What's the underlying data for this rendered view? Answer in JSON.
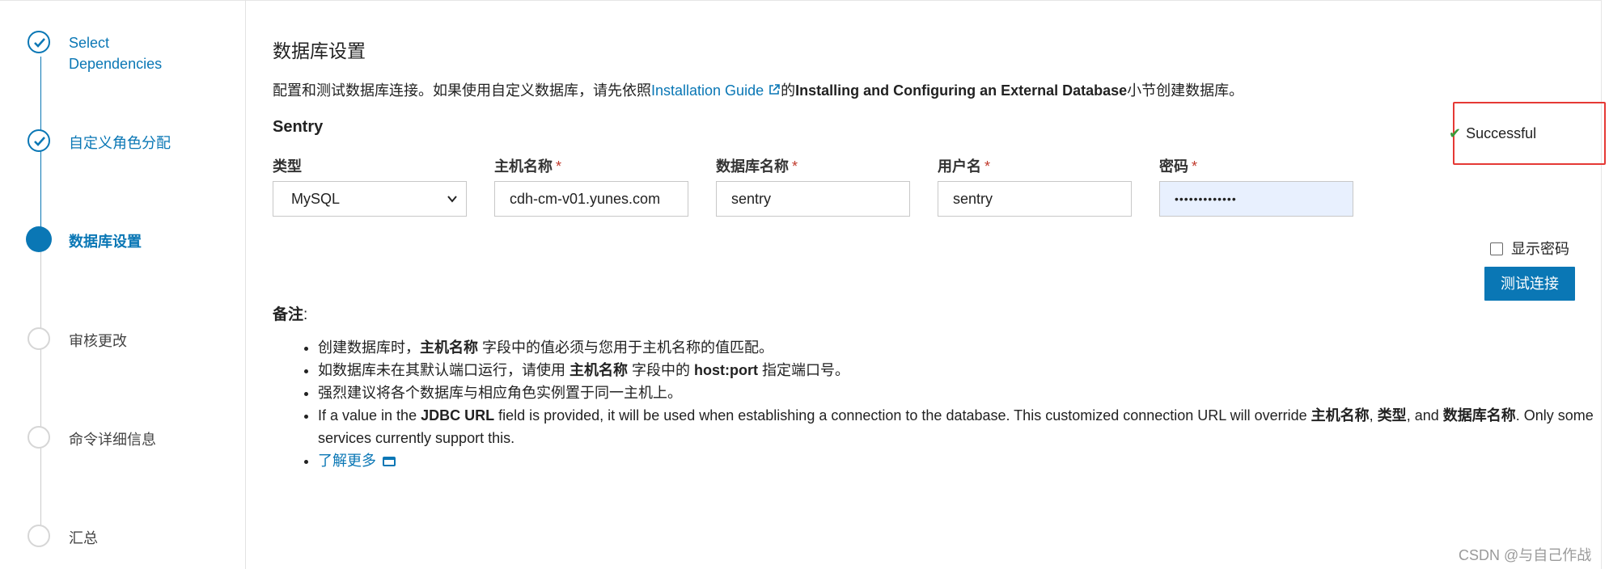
{
  "sidebar": {
    "steps": [
      {
        "label": "Select\nDependencies",
        "state": "done"
      },
      {
        "label": "自定义角色分配",
        "state": "done"
      },
      {
        "label": "数据库设置",
        "state": "current"
      },
      {
        "label": "审核更改",
        "state": "todo"
      },
      {
        "label": "命令详细信息",
        "state": "todo"
      },
      {
        "label": "汇总",
        "state": "todo"
      }
    ]
  },
  "main": {
    "title": "数据库设置",
    "intro": {
      "prefix": "配置和测试数据库连接。如果使用自定义数据库，请先依照",
      "link": "Installation Guide",
      "middle": "的",
      "bold": "Installing and Configuring an External Database",
      "suffix": "小节创建数据库。"
    },
    "service": "Sentry",
    "status": "Successful",
    "fields": {
      "type": {
        "label": "类型",
        "value": "MySQL"
      },
      "host": {
        "label": "主机名称",
        "value": "cdh-cm-v01.yunes.com"
      },
      "dbname": {
        "label": "数据库名称",
        "value": "sentry"
      },
      "user": {
        "label": "用户名",
        "value": "sentry"
      },
      "password": {
        "label": "密码",
        "value": "•••••••••••••"
      }
    },
    "required_mark": "*",
    "show_password_label": "显示密码",
    "test_button": "测试连接",
    "notes": {
      "title": "备注",
      "colon": ":",
      "n1_a": "创建数据库时，",
      "n1_b": "主机名称",
      "n1_c": " 字段中的值必须与您用于主机名称的值匹配。",
      "n2_a": "如数据库未在其默认端口运行，请使用 ",
      "n2_b": "主机名称",
      "n2_c": " 字段中的 ",
      "n2_d": "host:port",
      "n2_e": " 指定端口号。",
      "n3": "强烈建议将各个数据库与相应角色实例置于同一主机上。",
      "n4_a": "If a value in the ",
      "n4_b": "JDBC URL",
      "n4_c": " field is provided, it will be used when establishing a connection to the database. This customized connection URL will override ",
      "n4_d": "主机名称",
      "n4_e": ", ",
      "n4_f": "类型",
      "n4_g": ", and ",
      "n4_h": "数据库名称",
      "n4_i": ". Only some services currently support this.",
      "learn_more": "了解更多"
    }
  },
  "watermark": "CSDN @与自己作战",
  "colors": {
    "accent": "#0a77b5",
    "success": "#3a9a3a",
    "highlight": "#e53935"
  }
}
